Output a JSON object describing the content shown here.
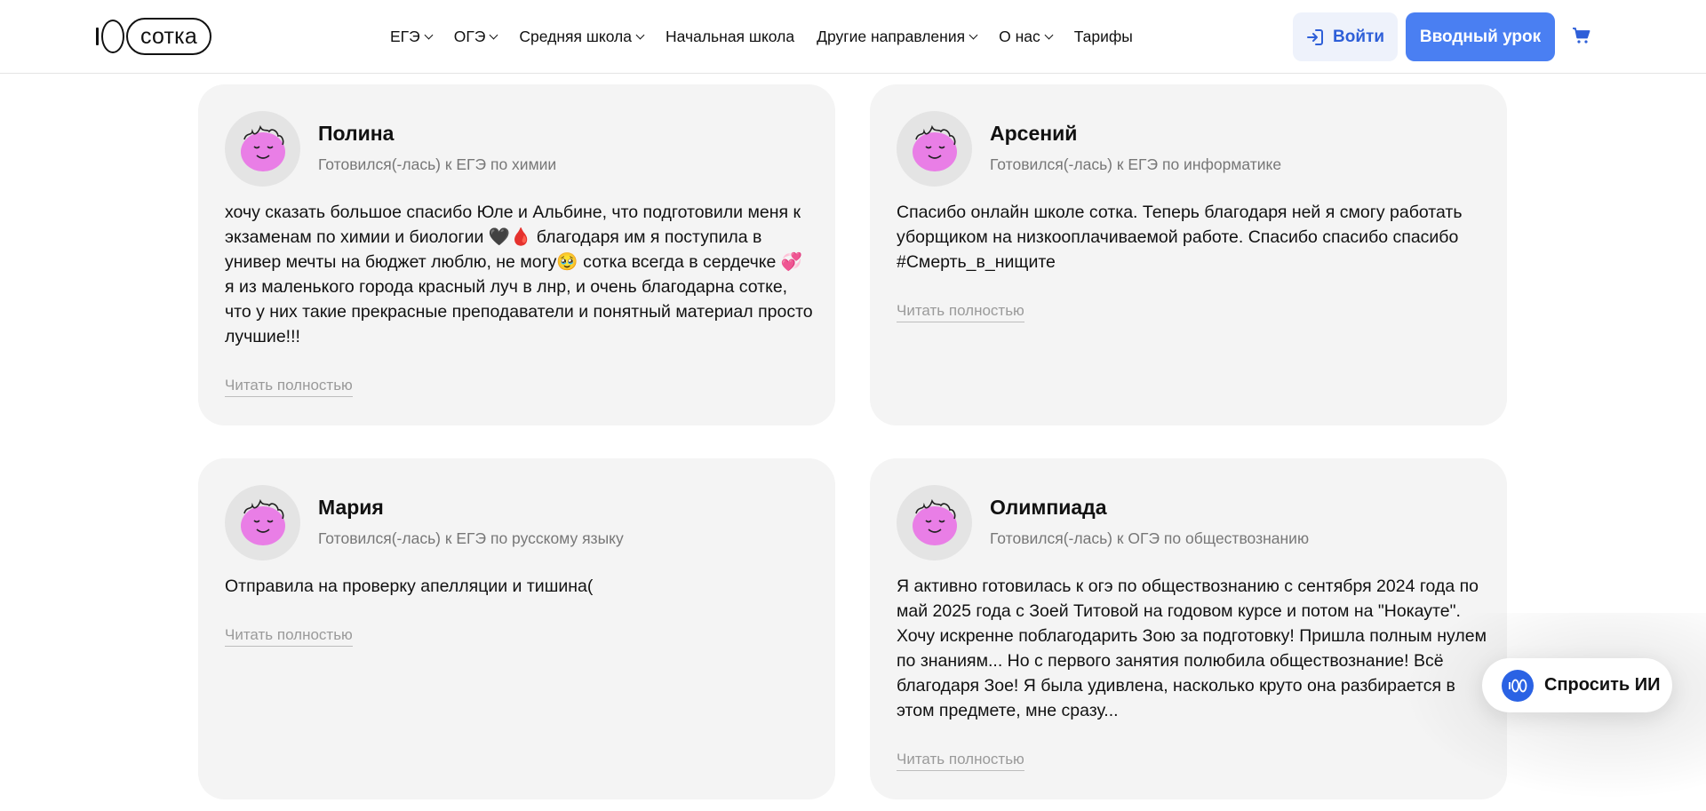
{
  "header": {
    "logo_text": "сотка",
    "nav": [
      {
        "label": "ЕГЭ",
        "dropdown": true
      },
      {
        "label": "ОГЭ",
        "dropdown": true
      },
      {
        "label": "Средняя школа",
        "dropdown": true
      },
      {
        "label": "Начальная школа",
        "dropdown": false
      },
      {
        "label": "Другие направления",
        "dropdown": true
      },
      {
        "label": "О нас",
        "dropdown": true
      },
      {
        "label": "Тарифы",
        "dropdown": false
      }
    ],
    "login_label": "Войти",
    "trial_label": "Вводный урок",
    "cart_icon": "cart-icon"
  },
  "reviews": [
    {
      "name": "Полина",
      "subject": "Готовился(-лась) к ЕГЭ по химии",
      "text": "хочу сказать большое спасибо Юле и Альбине, что подготовили меня к экзаменам по химии и биологии 🖤🩸 благодаря им я поступила в универ мечты на бюджет люблю, не могу🥹  сотка всегда в сердечке 💞 я из маленького города красный луч в лнр, и очень благодарна сотке, что у них такие прекрасные преподаватели и понятный материал просто лучшие!!!",
      "read_more": "Читать полностью"
    },
    {
      "name": "Арсений",
      "subject": "Готовился(-лась) к ЕГЭ по информатике",
      "text": "Спасибо онлайн школе сотка. Теперь благодаря ней я смогу работать уборщиком на низкооплачиваемой работе. Спасибо спасибо спасибо  #Смерть_в_нищите",
      "read_more": "Читать полностью"
    },
    {
      "name": "Мария",
      "subject": "Готовился(-лась) к ЕГЭ по русскому языку",
      "text": "Отправила на проверку апелляции и тишина(",
      "read_more": "Читать полностью"
    },
    {
      "name": "Олимпиада",
      "subject": "Готовился(-лась) к ОГЭ по обществознанию",
      "text": "Я активно готовилась к огэ по обществознанию с сентября 2024 года по май 2025 года с Зоей Титовой на годовом курсе и потом на \"Нокауте\". Хочу искренне поблагодарить Зою за подготовку! Пришла полным нулем по знаниям... Но с первого занятия полюбила обществознание! Всё благодаря Зое! Я была удивлена, насколько круто она разбирается в этом предмете, мне сразу...",
      "read_more": "Читать полностью"
    }
  ],
  "ask_ai": {
    "label": "Спросить ИИ"
  },
  "colors": {
    "accent": "#4a7ff2",
    "login_text": "#2e5fd8",
    "card_bg": "#f4f4f4",
    "avatar_pink": "#e97ee6"
  }
}
